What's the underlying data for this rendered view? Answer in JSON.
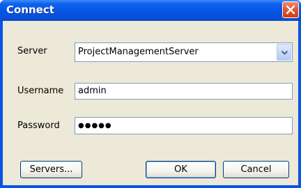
{
  "window": {
    "title": "Connect"
  },
  "form": {
    "server_label": "Server",
    "server_value": "ProjectManagementServer",
    "username_label": "Username",
    "username_value": "admin",
    "password_label": "Password",
    "password_value": "●●●●●"
  },
  "buttons": {
    "servers": "Servers...",
    "ok": "OK",
    "cancel": "Cancel"
  },
  "icons": {
    "close": "close-icon",
    "dropdown": "chevron-down-icon"
  },
  "colors": {
    "titlebar": "#0555e4",
    "close_button": "#e25a33",
    "dialog_background": "#ece9d8",
    "field_border": "#7f9db9"
  }
}
